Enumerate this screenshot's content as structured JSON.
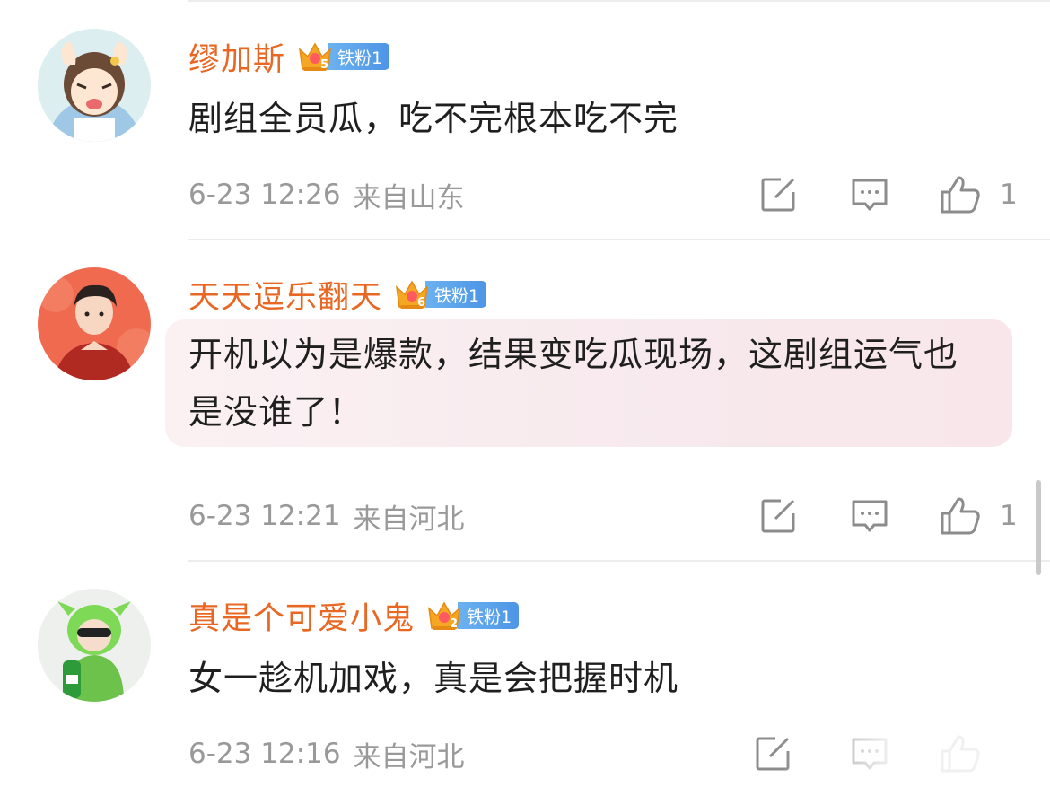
{
  "colors": {
    "username": "#e86722",
    "body_text": "#1f1f1f",
    "meta_text": "#999999",
    "badge_tag": "#5aa2eb",
    "highlight_bg": "#f8ecef"
  },
  "comments": [
    {
      "username": "缪加斯",
      "badge": {
        "level": "5",
        "label": "铁粉1"
      },
      "text": "剧组全员瓜，吃不完根本吃不完",
      "time": "6-23 12:26",
      "location": "来自山东",
      "likes": "1",
      "avatar": "anime-girl-avatar"
    },
    {
      "username": "天天逗乐翻天",
      "badge": {
        "level": "6",
        "label": "铁粉1"
      },
      "text": "开机以为是爆款，结果变吃瓜现场，这剧组运气也是没谁了！",
      "time": "6-23 12:21",
      "location": "来自河北",
      "likes": "1",
      "highlighted": true,
      "avatar": "man-red-jacket-avatar"
    },
    {
      "username": "真是个可爱小鬼",
      "badge": {
        "level": "2",
        "label": "铁粉1"
      },
      "text": "女一趁机加戏，真是会把握时机",
      "time": "6-23 12:16",
      "location": "来自河北",
      "likes": "",
      "avatar": "child-green-costume-avatar"
    }
  ],
  "icons": {
    "share": "edit-share-icon",
    "comment": "comment-bubble-icon",
    "like": "thumbs-up-icon"
  }
}
